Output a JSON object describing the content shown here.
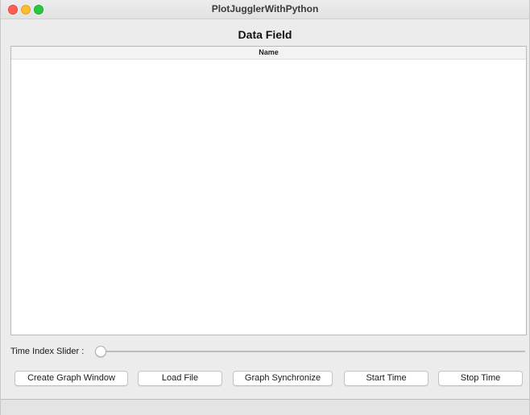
{
  "window": {
    "title": "PlotJugglerWithPython",
    "controls": {
      "close_color": "#ff5f57",
      "minimize_color": "#febc2e",
      "maximize_color": "#28c840"
    }
  },
  "data_field": {
    "title": "Data Field",
    "table": {
      "columns": [
        "Name"
      ],
      "rows": []
    }
  },
  "slider": {
    "label": "Time Index Slider :",
    "value": 0
  },
  "buttons": {
    "create_graph_window": "Create Graph Window",
    "load_file": "Load File",
    "graph_synchronize": "Graph Synchronize",
    "start_time": "Start Time",
    "stop_time": "Stop Time"
  }
}
